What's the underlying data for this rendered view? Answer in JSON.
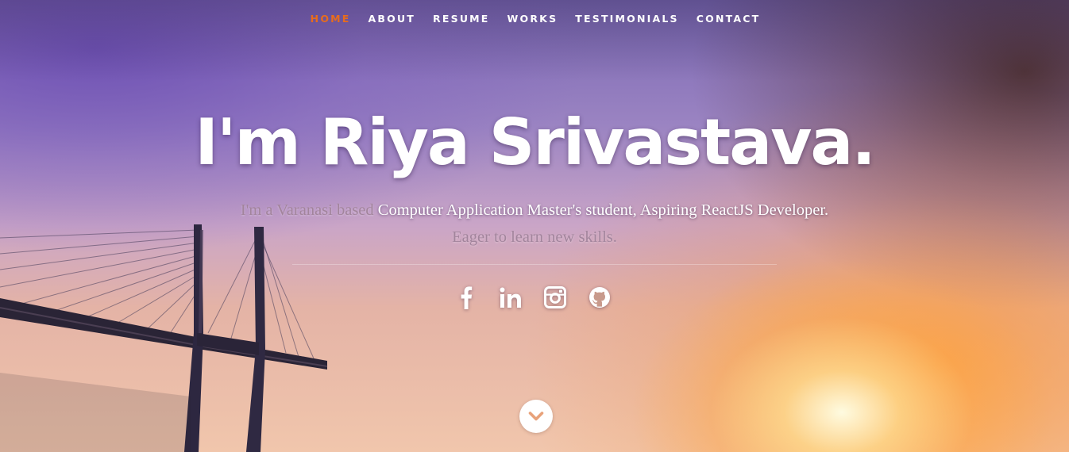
{
  "nav": {
    "items": [
      {
        "label": "HOME",
        "active": true
      },
      {
        "label": "ABOUT",
        "active": false
      },
      {
        "label": "RESUME",
        "active": false
      },
      {
        "label": "WORKS",
        "active": false
      },
      {
        "label": "TESTIMONIALS",
        "active": false
      },
      {
        "label": "CONTACT",
        "active": false
      }
    ],
    "active_color": "#e86c1c"
  },
  "hero": {
    "headline": "I'm Riya Srivastava.",
    "intro_part1": "I'm a Varanasi based",
    "intro_part2": "Computer Application Master's student, Aspiring ReactJS Developer.",
    "intro_part3": "Eager to learn new skills."
  },
  "social": [
    {
      "icon": "facebook-icon"
    },
    {
      "icon": "linkedin-icon"
    },
    {
      "icon": "instagram-icon"
    },
    {
      "icon": "github-icon"
    }
  ],
  "scroll_button": {
    "icon": "chevron-down-icon"
  },
  "colors": {
    "accent": "#e86c1c",
    "text": "#ffffff",
    "muted_text": "#a2849c"
  }
}
